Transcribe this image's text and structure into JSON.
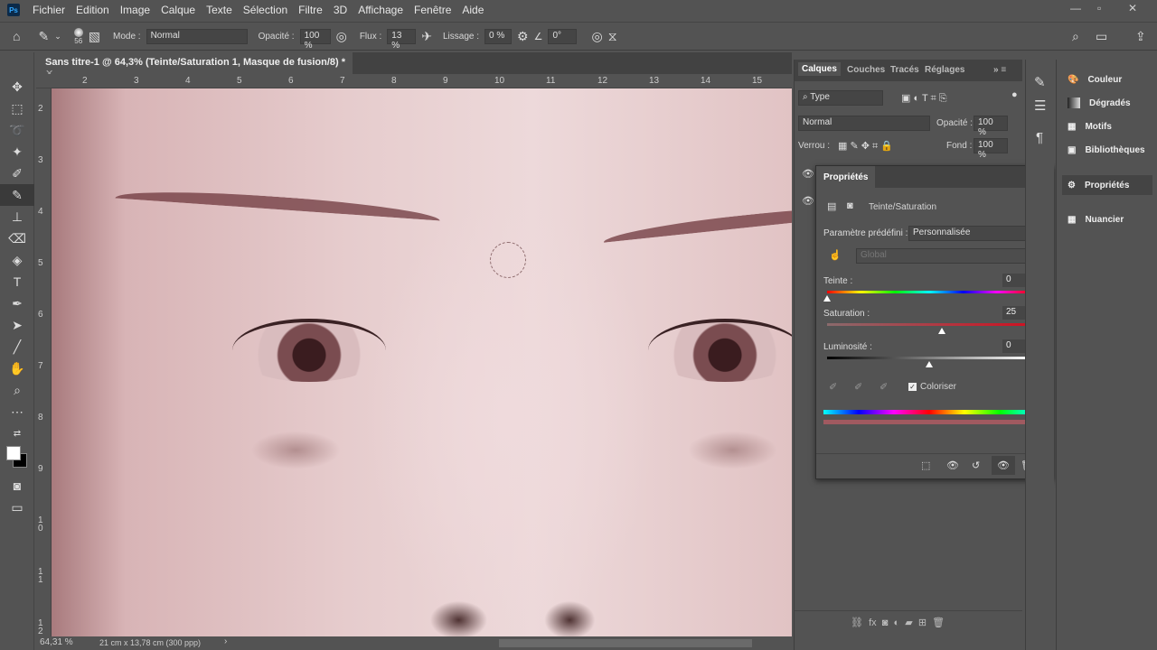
{
  "app": {
    "logo": "Ps"
  },
  "menu": [
    "Fichier",
    "Edition",
    "Image",
    "Calque",
    "Texte",
    "Sélection",
    "Filtre",
    "3D",
    "Affichage",
    "Fenêtre",
    "Aide"
  ],
  "options": {
    "brush_size": "56",
    "mode_label": "Mode :",
    "mode_value": "Normal",
    "opacity_label": "Opacité :",
    "opacity_value": "100 %",
    "flow_label": "Flux :",
    "flow_value": "13 %",
    "smoothing_label": "Lissage :",
    "smoothing_value": "0 %",
    "angle_value": "0°"
  },
  "document": {
    "tab_title": "Sans titre-1 @ 64,3% (Teinte/Saturation 1, Masque de fusion/8) *",
    "h_ruler": [
      "2",
      "3",
      "4",
      "5",
      "6",
      "7",
      "8",
      "9",
      "10",
      "11",
      "12",
      "13",
      "14",
      "15"
    ],
    "v_ruler": [
      "2",
      "3",
      "4",
      "5",
      "6",
      "7",
      "8",
      "9",
      "1 0",
      "1 1",
      "1 2"
    ]
  },
  "status": {
    "zoom": "64,31 %",
    "doc_size": "21 cm x 13,78 cm (300 ppp)"
  },
  "layers_panel": {
    "tabs": [
      "Calques",
      "Couches",
      "Tracés",
      "Réglages"
    ],
    "filter": "Type",
    "blend": "Normal",
    "opacity_label": "Opacité :",
    "opacity": "100 %",
    "lock_label": "Verrou :",
    "fill_label": "Fond :",
    "fill": "100 %"
  },
  "properties": {
    "title": "Propriétés",
    "adjustment": "Teinte/Saturation",
    "preset_label": "Paramètre prédéfini :",
    "preset_value": "Personnalisée",
    "channel": "Global",
    "hue_label": "Teinte :",
    "hue": "0",
    "sat_label": "Saturation :",
    "sat": "25",
    "light_label": "Luminosité :",
    "light": "0",
    "colorize_label": "Coloriser",
    "colorize_checked": true,
    "hue_fraction": 0.0,
    "sat_fraction": 0.56,
    "light_fraction": 0.5
  },
  "right_panels": [
    "Couleur",
    "Dégradés",
    "Motifs",
    "Bibliothèques",
    "Propriétés",
    "Nuancier"
  ]
}
